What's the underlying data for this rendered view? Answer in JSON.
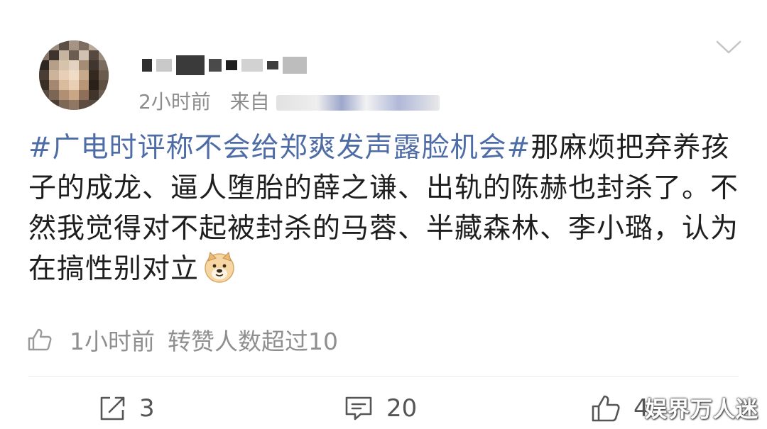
{
  "header": {
    "time": "2小时前",
    "source_prefix": "来自",
    "icons": {
      "expand": "chevron-down-icon"
    }
  },
  "post": {
    "hashtag": "#广电时评称不会给郑爽发声露脸机会#",
    "text": "那麻烦把弃养孩子的成龙、逼人堕胎的薛之谦、出轨的陈赫也封杀了。不然我觉得对不起被封杀的马蓉、半藏森林、李小璐，认为在搞性别对立",
    "emoji": "doge-emoji"
  },
  "reply_meta": {
    "time": "1小时前",
    "status": "转赞人数超过10",
    "icon": "thumbs-up-icon"
  },
  "actions": {
    "repost": {
      "icon": "share-icon",
      "count": "3"
    },
    "comment": {
      "icon": "comment-icon",
      "count": "20"
    },
    "like": {
      "icon": "thumbs-up-icon",
      "count": "4"
    }
  },
  "watermark": "娱界万人迷",
  "colors": {
    "hashtag": "#4e6ca5",
    "meta": "#8c8c8c",
    "text": "#1e1e1e"
  }
}
